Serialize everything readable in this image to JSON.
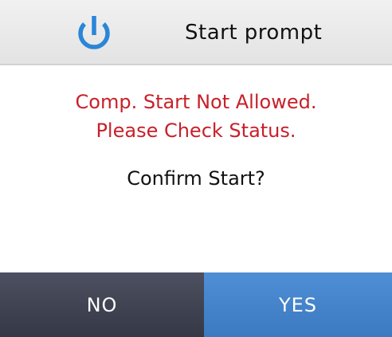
{
  "header": {
    "title": "Start prompt",
    "icon": "power-icon",
    "icon_color": "#2a86d8"
  },
  "message": {
    "warning_line1": "Comp. Start Not Allowed.",
    "warning_line2": "Please Check Status.",
    "warning_color": "#c8202a",
    "confirm_text": "Confirm Start?"
  },
  "buttons": {
    "no_label": "NO",
    "no_text_color": "#ffffff",
    "yes_label": "YES",
    "yes_text_color": "#ffffff"
  }
}
